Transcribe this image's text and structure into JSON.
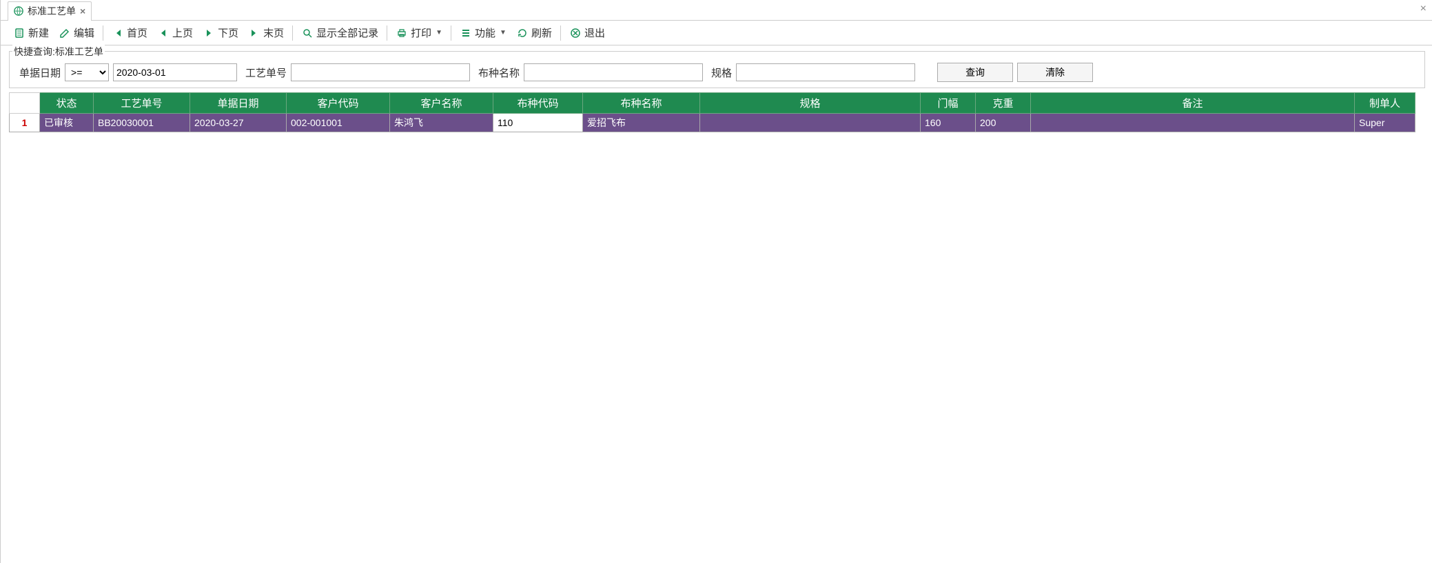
{
  "tab": {
    "title": "标准工艺单"
  },
  "toolbar": {
    "new": "新建",
    "edit": "编辑",
    "first": "首页",
    "prev": "上页",
    "next": "下页",
    "last": "末页",
    "showAll": "显示全部记录",
    "print": "打印",
    "func": "功能",
    "refresh": "刷新",
    "exit": "退出"
  },
  "query": {
    "legend": "快捷查询:标准工艺单",
    "dateLabel": "单据日期",
    "operator": ">=",
    "dateValue": "2020-03-01",
    "orderNoLabel": "工艺单号",
    "orderNoValue": "",
    "fabricNameLabel": "布种名称",
    "fabricNameValue": "",
    "specLabel": "规格",
    "specValue": "",
    "searchBtn": "查询",
    "clearBtn": "清除"
  },
  "columns": {
    "status": "状态",
    "orderNo": "工艺单号",
    "date": "单据日期",
    "custCode": "客户代码",
    "custName": "客户名称",
    "fabricCode": "布种代码",
    "fabricName": "布种名称",
    "spec": "规格",
    "width": "门幅",
    "weight": "克重",
    "remark": "备注",
    "creator": "制单人"
  },
  "rows": [
    {
      "num": "1",
      "status": "已审核",
      "orderNo": "BB20030001",
      "date": "2020-03-27",
      "custCode": "002-001001",
      "custName": "朱鸿飞",
      "fabricCode": "110",
      "fabricName": "爱招飞布",
      "spec": "",
      "width": "160",
      "weight": "200",
      "remark": "",
      "creator": "Super"
    }
  ]
}
